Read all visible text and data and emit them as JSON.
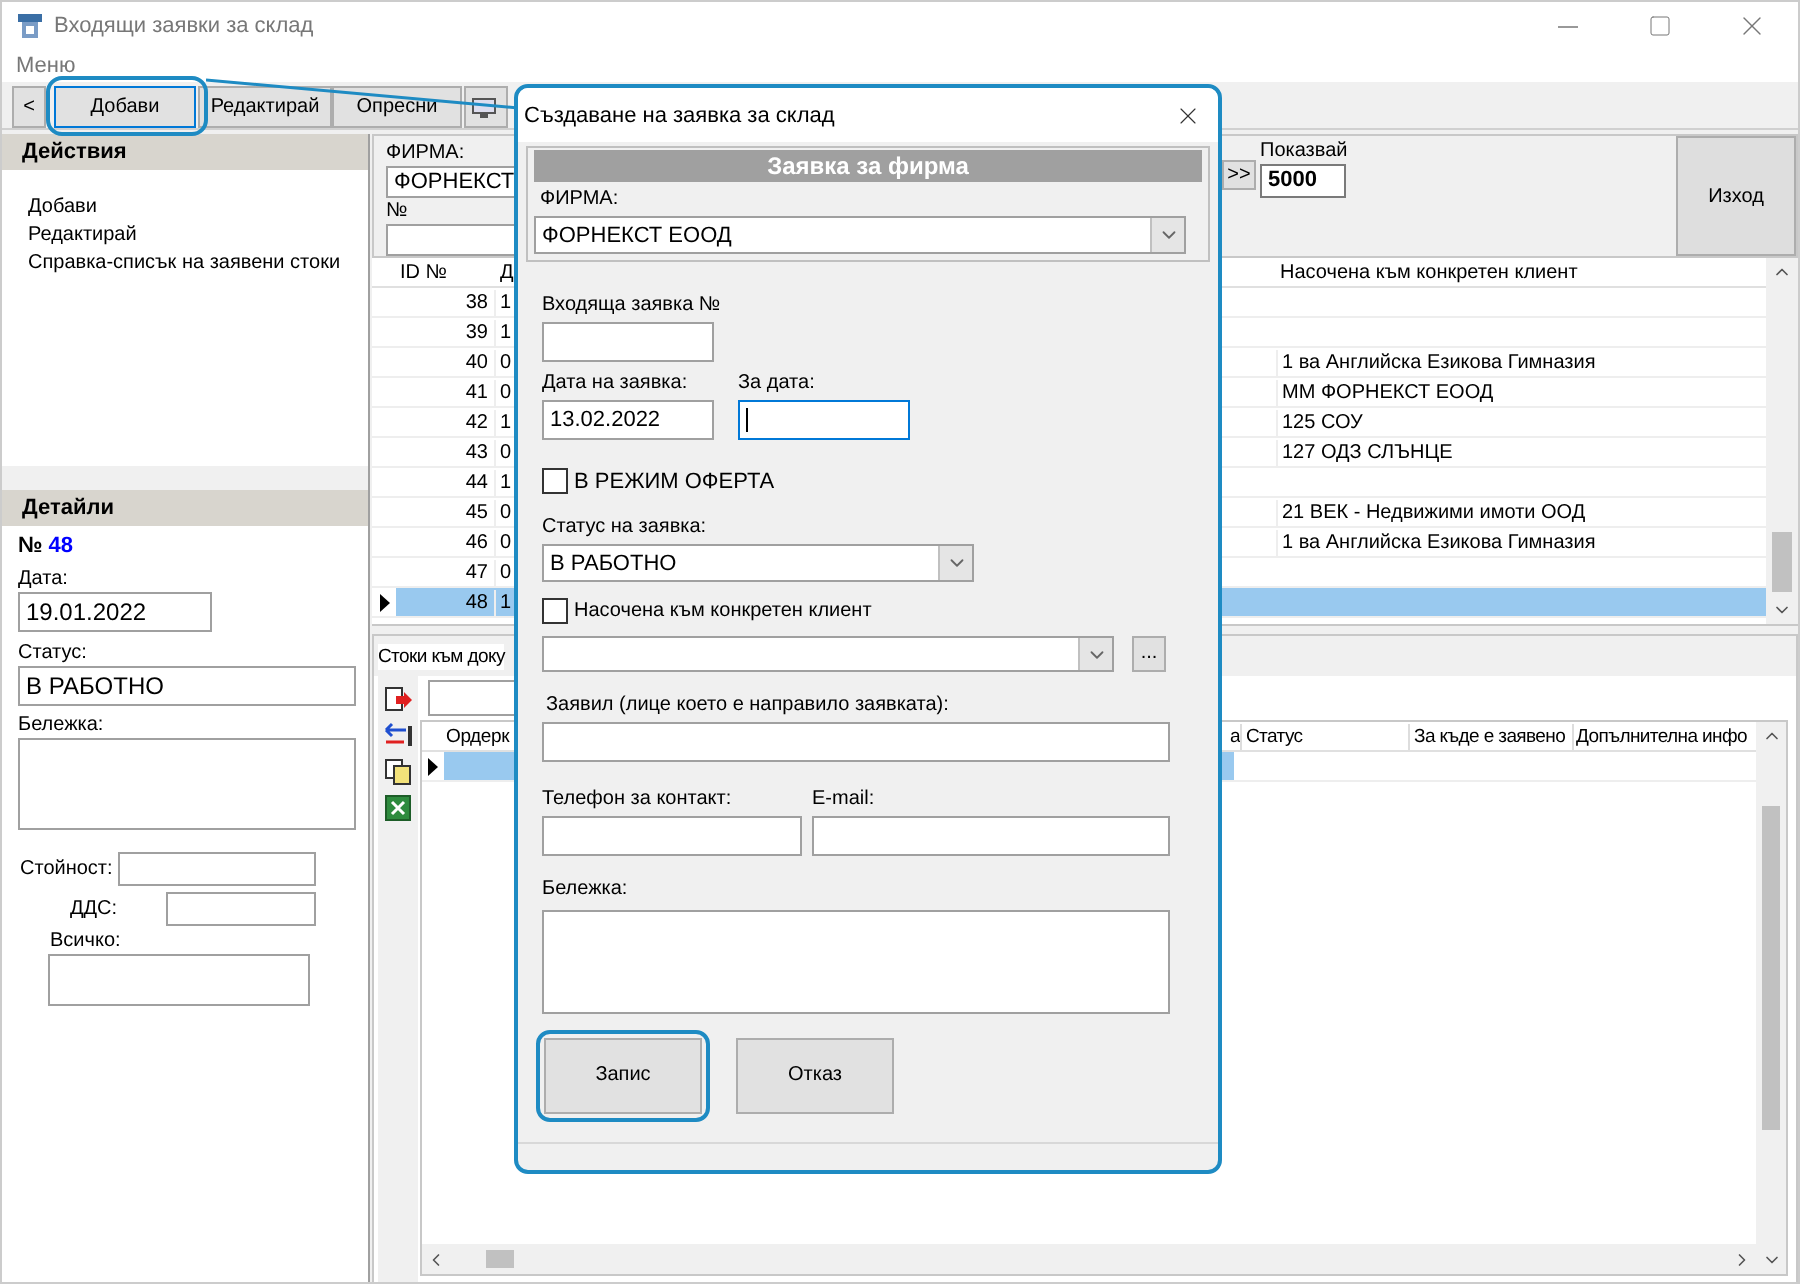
{
  "window": {
    "title": "Входящи заявки за склад"
  },
  "menu": [
    "Меню"
  ],
  "toolbar": [
    {
      "label": "<",
      "highlighted": false
    },
    {
      "label": "Добави",
      "highlighted": true
    },
    {
      "label": "Редактирай",
      "highlighted": false
    },
    {
      "label": "Опресни",
      "highlighted": false
    }
  ],
  "actions": {
    "title": "Действия",
    "items": [
      "Добави",
      "Редактирай",
      "Справка-списък на заявени стоки"
    ]
  },
  "details": {
    "title": "Детайли",
    "number_label": "№",
    "number": "48",
    "date_label": "Дата:",
    "date": "19.01.2022",
    "status_label": "Статус:",
    "status": "В РАБОТНО",
    "note_label": "Бележка:",
    "value_label": "Стойност:",
    "vat_label": "ДДС:",
    "total_label": "Всичко:"
  },
  "filter": {
    "firm_label": "ФИРМА:",
    "firm": "ФОРНЕКСТ",
    "number_label": "№",
    "next_button": ">>",
    "show_label": "Показвай",
    "show": "5000",
    "exit_button": "Изход"
  },
  "orders_table": {
    "columns": [
      "ID №",
      "Д",
      "Насочена към конкретен клиент"
    ],
    "rows": [
      {
        "id": "38",
        "date": "1",
        "client": "",
        "selected": false
      },
      {
        "id": "39",
        "date": "1",
        "client": "",
        "selected": false
      },
      {
        "id": "40",
        "date": "0",
        "client": "1 ва Английска Езикова Гимназия",
        "selected": false
      },
      {
        "id": "41",
        "date": "0",
        "client": "ММ ФОРНЕКСТ ЕООД",
        "selected": false
      },
      {
        "id": "42",
        "date": "1",
        "client": "125 СОУ",
        "selected": false
      },
      {
        "id": "43",
        "date": "0",
        "client": "127 ОДЗ СЛЪНЦЕ",
        "selected": false
      },
      {
        "id": "44",
        "date": "1",
        "client": "",
        "selected": false
      },
      {
        "id": "45",
        "date": "0",
        "client": "21 ВЕК - Недвижими имоти ООД",
        "selected": false
      },
      {
        "id": "46",
        "date": "0",
        "client": "1 ва Английска Езикова Гимназия",
        "selected": false
      },
      {
        "id": "47",
        "date": "0",
        "client": "",
        "selected": false
      },
      {
        "id": "48",
        "date": "1",
        "client": "",
        "selected": true
      }
    ]
  },
  "items_panel": {
    "tab": "Стоки към доку",
    "columns": [
      "Ордерк",
      "а",
      "Статус",
      "За къде е заявено",
      "Допълнителна инфо"
    ],
    "rows": [
      {
        "selected": true
      }
    ]
  },
  "dialog": {
    "title": "Създаване на заявка за склад",
    "header": "Заявка за фирма",
    "firm_label": "ФИРМА:",
    "firm": "ФОРНЕКСТ ЕООД",
    "incoming_label": "Входяща заявка №",
    "order_date_label": "Дата на заявка:",
    "order_date": "13.02.2022",
    "for_date_label": "За дата:",
    "for_date_focused": true,
    "offer_mode": {
      "label": "В РЕЖИМ ОФЕРТА",
      "checked": false
    },
    "status_label": "Статус на заявка:",
    "status": "В РАБОТНО",
    "directed": {
      "label": "Насочена към конкретен клиент",
      "checked": false
    },
    "browse_button": "...",
    "requester_label": "Заявил (лице което е направило заявката):",
    "phone_label": "Телефон за контакт:",
    "email_label": "E-mail:",
    "note_label": "Бележка:",
    "buttons": [
      {
        "label": "Запис",
        "highlighted": true
      },
      {
        "label": "Отказ",
        "highlighted": false
      }
    ]
  }
}
